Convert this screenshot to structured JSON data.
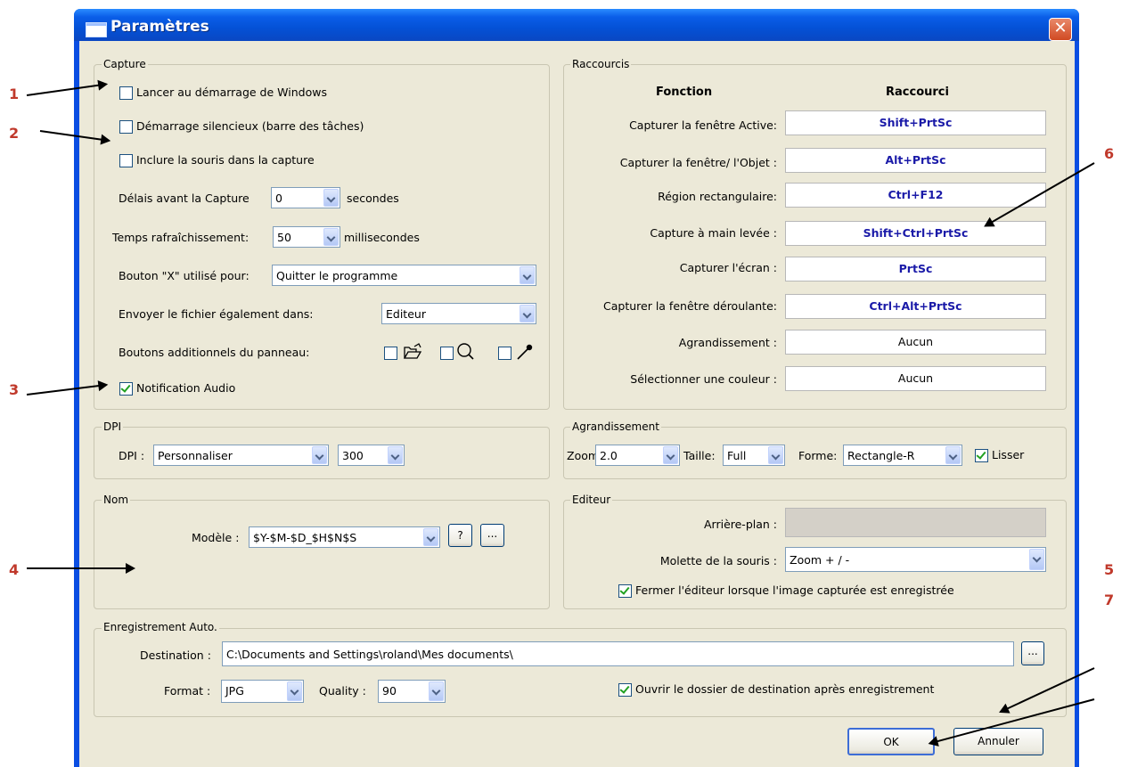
{
  "window": {
    "title": "Paramètres",
    "close": "✕"
  },
  "annotations": {
    "n1": "1",
    "n2": "2",
    "n3": "3",
    "n4": "4",
    "n5": "5",
    "n6": "6",
    "n7": "7"
  },
  "capture": {
    "legend": "Capture",
    "launch_windows": "Lancer au démarrage de Windows",
    "silent_start": "Démarrage silencieux (barre des tâches)",
    "include_mouse": "Inclure la souris dans la capture",
    "delay_label": "Délais avant la Capture",
    "delay_value": "0",
    "delay_unit": "secondes",
    "refresh_label": "Temps rafraîchissement:",
    "refresh_value": "50",
    "refresh_unit": "millisecondes",
    "x_button_label": "Bouton \"X\" utilisé pour:",
    "x_button_value": "Quitter le programme",
    "send_label": "Envoyer le fichier également dans:",
    "send_value": "Editeur",
    "panel_buttons_label": "Boutons additionnels du panneau:",
    "audio": "Notification Audio"
  },
  "shortcuts": {
    "legend": "Raccourcis",
    "col_function": "Fonction",
    "col_shortcut": "Raccourci",
    "rows": [
      {
        "label": "Capturer la fenêtre Active:",
        "key": "Shift+PrtSc"
      },
      {
        "label": "Capturer la fenêtre/ l'Objet :",
        "key": "Alt+PrtSc"
      },
      {
        "label": "Région rectangulaire:",
        "key": "Ctrl+F12"
      },
      {
        "label": "Capture à main levée :",
        "key": "Shift+Ctrl+PrtSc"
      },
      {
        "label": "Capturer l'écran :",
        "key": "PrtSc"
      },
      {
        "label": "Capturer la fenêtre déroulante:",
        "key": "Ctrl+Alt+PrtSc"
      },
      {
        "label": "Agrandissement :",
        "key": "Aucun"
      },
      {
        "label": "Sélectionner une couleur :",
        "key": "Aucun"
      }
    ]
  },
  "dpi": {
    "legend": "DPI",
    "label": "DPI :",
    "mode": "Personnaliser",
    "value": "300"
  },
  "zoom": {
    "legend": "Agrandissement",
    "zoom_label": "Zoom:",
    "zoom_value": "2.0",
    "size_label": "Taille:",
    "size_value": "Full",
    "shape_label": "Forme:",
    "shape_value": "Rectangle-R",
    "smooth": "Lisser"
  },
  "name": {
    "legend": "Nom",
    "model_label": "Modèle :",
    "model_value": "$Y-$M-$D_$H$N$S",
    "help": "?",
    "more": "..."
  },
  "editor": {
    "legend": "Editeur",
    "background_label": "Arrière-plan :",
    "wheel_label": "Molette de la souris :",
    "wheel_value": "Zoom + / -",
    "close_editor": "Fermer l'éditeur lorsque l'image capturée est enregistrée"
  },
  "autosave": {
    "legend": "Enregistrement Auto.",
    "dest_label": "Destination :",
    "dest_value": "C:\\Documents and Settings\\roland\\Mes documents\\",
    "browse": "...",
    "format_label": "Format :",
    "format_value": "JPG",
    "quality_label": "Quality :",
    "quality_value": "90",
    "open_folder": "Ouvrir le dossier de destination après enregistrement"
  },
  "footer": {
    "ok": "OK",
    "cancel": "Annuler"
  }
}
